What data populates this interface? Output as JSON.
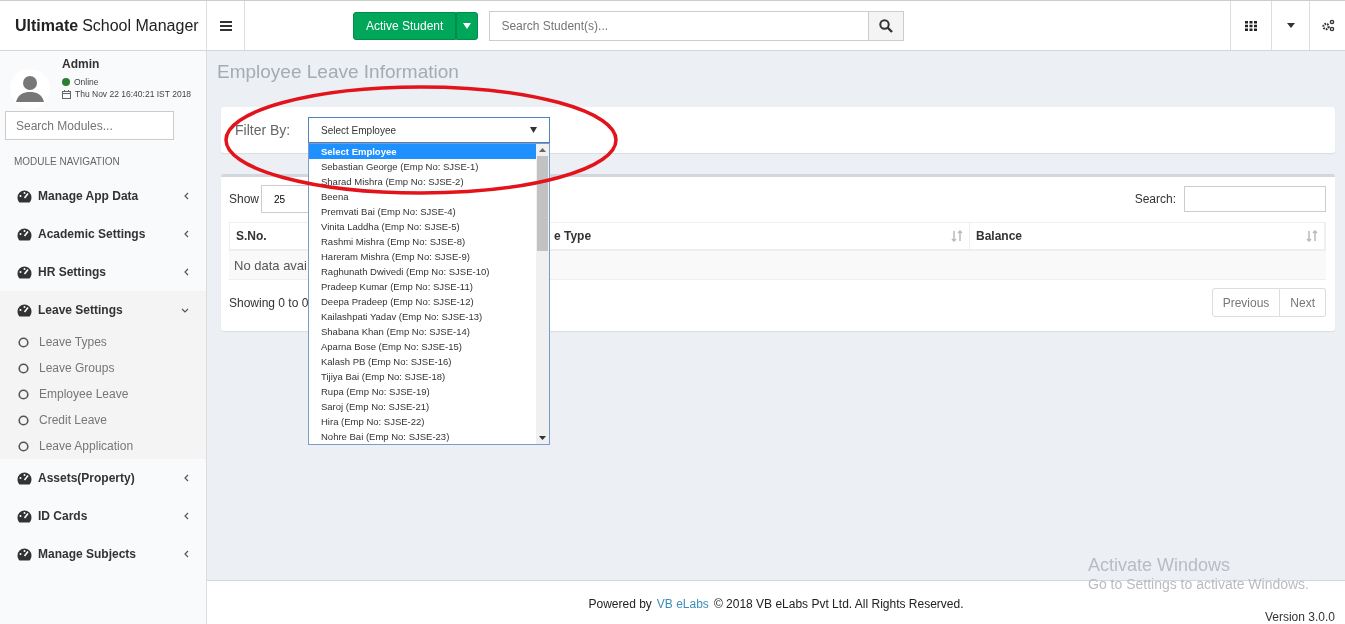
{
  "brand": {
    "bold": "Ultimate",
    "rest": "School Manager"
  },
  "topbar": {
    "active_button": "Active Student",
    "search": {
      "placeholder": "Search Student(s)..."
    }
  },
  "user": {
    "name": "Admin",
    "status": "Online",
    "online": true,
    "datetime": "Thu Nov 22 16:40:21 IST 2018"
  },
  "module_search": {
    "placeholder": "Search Modules..."
  },
  "nav_header": "MODULE NAVIGATION",
  "nav": [
    {
      "label": "Manage App Data",
      "expanded": false
    },
    {
      "label": "Academic Settings",
      "expanded": false
    },
    {
      "label": "HR Settings",
      "expanded": false
    },
    {
      "label": "Leave Settings",
      "expanded": true,
      "children": [
        {
          "label": "Leave Types"
        },
        {
          "label": "Leave Groups"
        },
        {
          "label": "Employee Leave"
        },
        {
          "label": "Credit Leave"
        },
        {
          "label": "Leave Application"
        }
      ]
    },
    {
      "label": "Assets(Property)",
      "expanded": false
    },
    {
      "label": "ID Cards",
      "expanded": false
    },
    {
      "label": "Manage Subjects",
      "expanded": false
    }
  ],
  "page_title": "Employee Leave Information",
  "filter": {
    "label": "Filter By:",
    "value": "Select Employee",
    "options": [
      {
        "label": "Select Employee",
        "selected": true
      },
      {
        "label": "Sebastian George (Emp No: SJSE-1)",
        "selected": false
      },
      {
        "label": "Sharad Mishra (Emp No: SJSE-2)",
        "selected": false
      },
      {
        "label": "Beena",
        "selected": false
      },
      {
        "label": "Premvati Bai (Emp No: SJSE-4)",
        "selected": false
      },
      {
        "label": "Vinita Laddha (Emp No: SJSE-5)",
        "selected": false
      },
      {
        "label": "Rashmi Mishra (Emp No: SJSE-8)",
        "selected": false
      },
      {
        "label": "Hareram Mishra (Emp No: SJSE-9)",
        "selected": false
      },
      {
        "label": "Raghunath Dwivedi (Emp No: SJSE-10)",
        "selected": false
      },
      {
        "label": "Pradeep Kumar (Emp No: SJSE-11)",
        "selected": false
      },
      {
        "label": "Deepa Pradeep (Emp No: SJSE-12)",
        "selected": false
      },
      {
        "label": "Kailashpati Yadav (Emp No: SJSE-13)",
        "selected": false
      },
      {
        "label": "Shabana Khan (Emp No: SJSE-14)",
        "selected": false
      },
      {
        "label": "Aparna Bose (Emp No: SJSE-15)",
        "selected": false
      },
      {
        "label": "Kalash PB (Emp No: SJSE-16)",
        "selected": false
      },
      {
        "label": "Tijiya Bai (Emp No: SJSE-18)",
        "selected": false
      },
      {
        "label": "Rupa (Emp No: SJSE-19)",
        "selected": false
      },
      {
        "label": "Saroj (Emp No: SJSE-21)",
        "selected": false
      },
      {
        "label": "Hira (Emp No: SJSE-22)",
        "selected": false
      },
      {
        "label": "Nohre Bai (Emp No: SJSE-23)",
        "selected": false
      }
    ]
  },
  "table": {
    "show_label": "Show",
    "page_length": "25",
    "search_label": "Search:",
    "columns": [
      {
        "label": "S.No."
      },
      {
        "label": "e Type",
        "sortable": true
      },
      {
        "label": "Balance",
        "sortable": true
      }
    ],
    "empty_text": "No data avai",
    "info": "Showing 0 to 0",
    "buttons": [
      "Previous",
      "Next"
    ]
  },
  "footer": {
    "powered": "Powered by",
    "link": "VB eLabs",
    "rest": "© 2018 VB eLabs Pvt Ltd. All Rights Reserved.",
    "version": "Version 3.0.0"
  },
  "os_notice": {
    "title": "Activate Windows",
    "text": "Go to Settings to activate Windows."
  }
}
